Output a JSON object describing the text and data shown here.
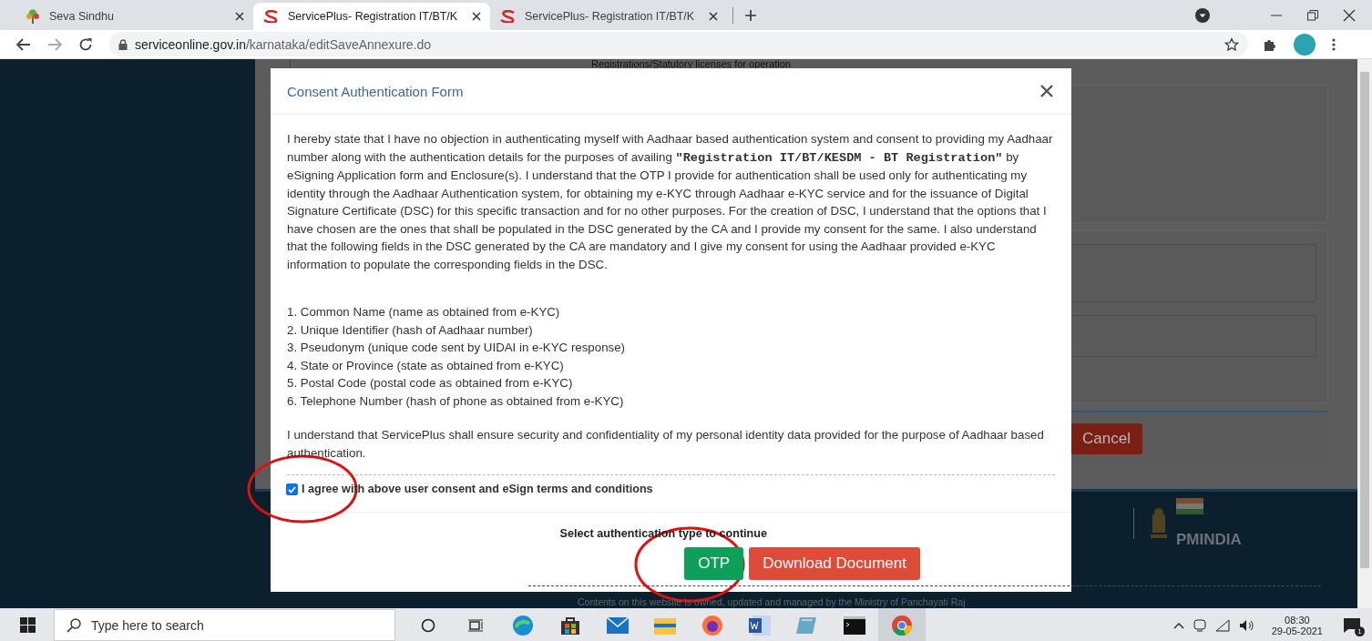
{
  "browser": {
    "tabs": [
      {
        "title": "Seva Sindhu",
        "kind": "seva",
        "selected": false
      },
      {
        "title": "ServicePlus- Registration IT/BT/K",
        "kind": "serviceplus",
        "selected": true
      },
      {
        "title": "ServicePlus- Registration IT/BT/K",
        "kind": "serviceplus",
        "selected": false
      }
    ],
    "address_bar": {
      "host": "serviceonline.gov.in",
      "path": "/karnataka/editSaveAnnexure.do"
    }
  },
  "background_page": {
    "heading_fragment": "Registrations/Statutory licenses for operation",
    "cancel_button": "Cancel",
    "footer_logo": "PMINDIA",
    "footer_note": "Contents on this website is owned, updated and managed by the Ministry of Panchayati Raj"
  },
  "modal": {
    "title": "Consent Authentication Form",
    "statement": "I hereby state that I have no objection in authenticating myself with Aadhaar based authentication system and consent to providing my Aadhaar number along with the authentication details for the purposes of availing **\"Registration IT/BT/KESDM - BT Registration\"** by eSigning Application form and Enclosure(s). I understand that the OTP I provide for authentication shall be used only for authenticating my identity through the Aadhaar Authentication system, for obtaining my e-KYC through Aadhaar e-KYC service and for the issuance of Digital Signature Certificate (DSC) for this specific transaction and for no other purposes. For the creation of DSC, I understand that the options that I have chosen are the ones that shall be populated in the DSC generated by the CA and I provide my consent for the same. I also understand that the following fields in the DSC generated by the CA are mandatory and I give my consent for using the Aadhaar provided e-KYC information to populate the corresponding fields in the DSC.",
    "fields": [
      "1. Common Name (name as obtained from e-KYC)",
      "2. Unique Identifier (hash of Aadhaar number)",
      "3. Pseudonym (unique code sent by UIDAI in e-KYC response)",
      "4. State or Province (state as obtained from e-KYC)",
      "5. Postal Code (postal code as obtained from e-KYC)",
      "6. Telephone Number (hash of phone as obtained from e-KYC)"
    ],
    "closing": "I understand that ServicePlus shall ensure security and confidentiality of my personal identity data provided for the purpose of Aadhaar based authentication.",
    "consent": {
      "label": "I agree with above user consent and eSign terms and conditions",
      "checked": true
    },
    "prompt": "Select authentication type to continue",
    "buttons": [
      {
        "label": "OTP",
        "kind": "success"
      },
      {
        "label": "Download Document",
        "kind": "danger"
      }
    ]
  },
  "taskbar": {
    "search_placeholder": "Type here to search",
    "time": "08:30",
    "date": "29-05-2021",
    "notifications": "1"
  }
}
